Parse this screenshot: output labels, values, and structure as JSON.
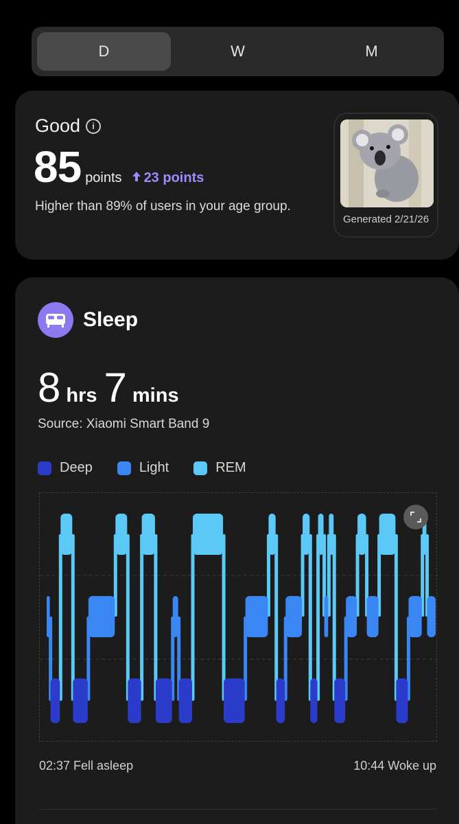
{
  "tabs": [
    {
      "label": "D",
      "active": true
    },
    {
      "label": "W",
      "active": false
    },
    {
      "label": "M",
      "active": false
    }
  ],
  "score": {
    "rating": "Good",
    "info_icon": "info-icon",
    "value": "85",
    "unit": "points",
    "delta": "23 points",
    "delta_icon": "arrow-up-icon",
    "comparison": "Higher than 89% of users in your age group.",
    "avatar_icon": "koala-illustration",
    "generated": "Generated 2/21/26"
  },
  "sleep": {
    "icon": "bed-icon",
    "title": "Sleep",
    "hours": "8",
    "hours_unit": "hrs",
    "minutes": "7",
    "minutes_unit": "mins",
    "source": "Source: Xiaomi Smart Band 9",
    "legend": [
      {
        "label": "Deep",
        "color": "#2a3cc9"
      },
      {
        "label": "Light",
        "color": "#3a86f2"
      },
      {
        "label": "REM",
        "color": "#5cc8f5"
      }
    ],
    "fell_asleep": "02:37 Fell asleep",
    "woke_up": "10:44 Woke up",
    "expand_icon": "expand-icon"
  },
  "colors": {
    "accent": "#9b8cff",
    "deep": "#2a3cc9",
    "light": "#3a86f2",
    "rem": "#5cc8f5",
    "badge": "#8d7af0"
  },
  "chart_data": {
    "type": "hypnogram",
    "stages": [
      "REM",
      "Light",
      "Deep"
    ],
    "start": "02:37",
    "end": "10:44",
    "segments": [
      {
        "stage": "Light",
        "w": 0.5
      },
      {
        "stage": "Deep",
        "w": 1.3
      },
      {
        "stage": "REM",
        "w": 1.6
      },
      {
        "stage": "Deep",
        "w": 2.0
      },
      {
        "stage": "Light",
        "w": 3.5
      },
      {
        "stage": "REM",
        "w": 1.6
      },
      {
        "stage": "Deep",
        "w": 1.8
      },
      {
        "stage": "REM",
        "w": 1.8
      },
      {
        "stage": "Deep",
        "w": 2.2
      },
      {
        "stage": "Light",
        "w": 0.8
      },
      {
        "stage": "Deep",
        "w": 1.8
      },
      {
        "stage": "REM",
        "w": 4.0
      },
      {
        "stage": "Deep",
        "w": 2.8
      },
      {
        "stage": "Light",
        "w": 3.0
      },
      {
        "stage": "REM",
        "w": 1.0
      },
      {
        "stage": "Deep",
        "w": 1.2
      },
      {
        "stage": "Light",
        "w": 2.2
      },
      {
        "stage": "REM",
        "w": 1.0
      },
      {
        "stage": "Deep",
        "w": 1.0
      },
      {
        "stage": "REM",
        "w": 0.8
      },
      {
        "stage": "Light",
        "w": 0.6
      },
      {
        "stage": "REM",
        "w": 0.7
      },
      {
        "stage": "Deep",
        "w": 1.5
      },
      {
        "stage": "Light",
        "w": 1.5
      },
      {
        "stage": "REM",
        "w": 1.2
      },
      {
        "stage": "Light",
        "w": 1.6
      },
      {
        "stage": "REM",
        "w": 2.2
      },
      {
        "stage": "Deep",
        "w": 1.6
      },
      {
        "stage": "Light",
        "w": 1.8
      },
      {
        "stage": "REM",
        "w": 0.6
      },
      {
        "stage": "Light",
        "w": 1.2
      }
    ]
  }
}
